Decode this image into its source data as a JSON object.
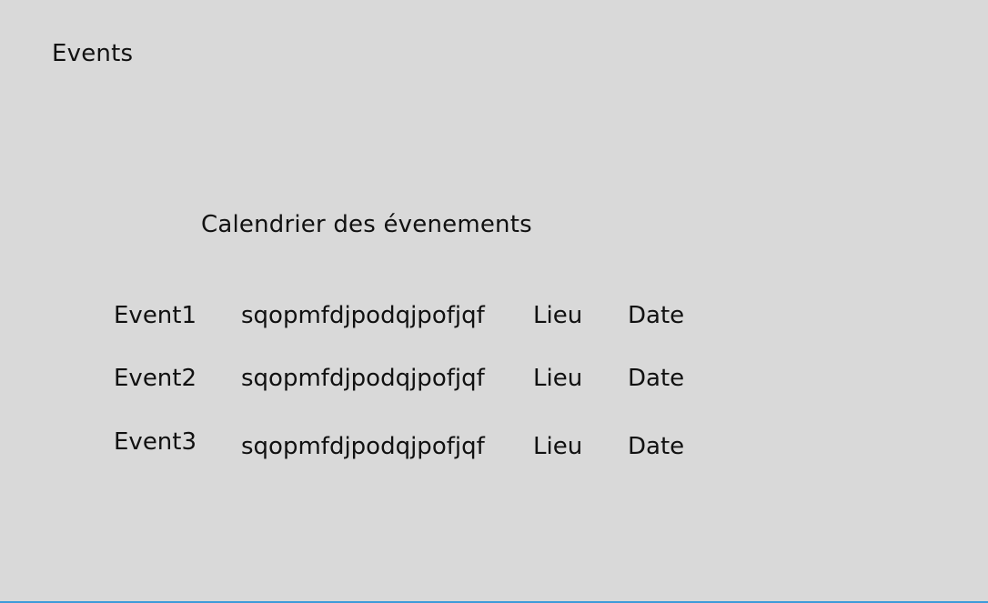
{
  "header": {
    "title": "Events"
  },
  "calendar": {
    "title": "Calendrier des évenements",
    "events": [
      {
        "name": "Event1",
        "description": "sqopmfdjpodqjpofjqf",
        "place": "Lieu",
        "date": "Date"
      },
      {
        "name": "Event2",
        "description": "sqopmfdjpodqjpofjqf",
        "place": "Lieu",
        "date": "Date"
      },
      {
        "name": "Event3",
        "description": "sqopmfdjpodqjpofjqf",
        "place": "Lieu",
        "date": "Date"
      }
    ]
  },
  "colors": {
    "background": "#d9d9d9",
    "accent_line": "#3d9ad9",
    "text": "#111111"
  }
}
